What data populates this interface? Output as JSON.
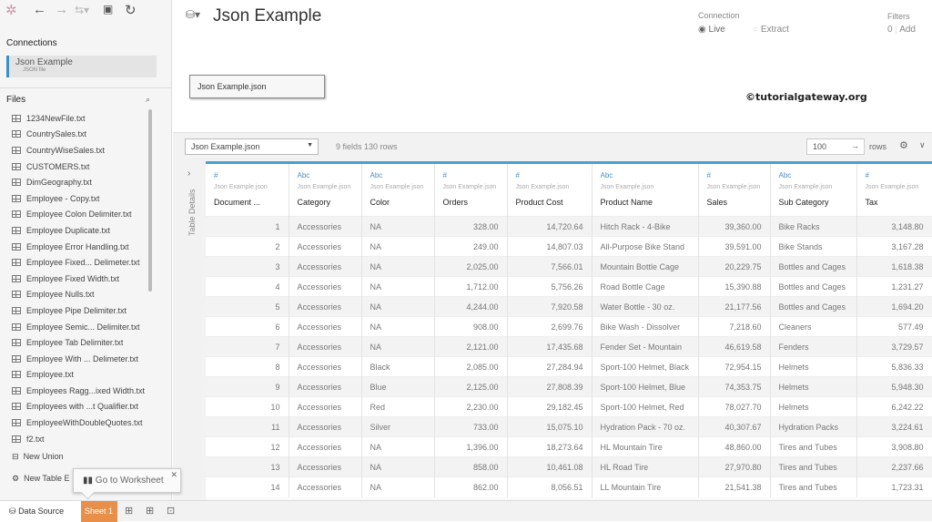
{
  "toolbar": {
    "icons": [
      "tableau-logo-icon",
      "back-icon",
      "forward-icon",
      "redo-icon",
      "save-icon",
      "refresh-icon"
    ]
  },
  "sidebar": {
    "connections_label": "Connections",
    "connection": {
      "name": "Json Example",
      "type": "JSON file"
    },
    "files_label": "Files",
    "files": [
      "1234NewFile.txt",
      "CountrySales.txt",
      "CountryWiseSales.txt",
      "CUSTOMERS.txt",
      "DimGeography.txt",
      "Employee - Copy.txt",
      "Employee Colon Delimiter.txt",
      "Employee Duplicate.txt",
      "Employee Error Handling.txt",
      "Employee Fixed... Delimeter.txt",
      "Employee Fixed Width.txt",
      "Employee Nulls.txt",
      "Employee Pipe Delimiter.txt",
      "Employee Semic... Delimiter.txt",
      "Employee Tab Delimiter.txt",
      "Employee With ... Delimeter.txt",
      "Employee.txt",
      "Employees Ragg...ixed Width.txt",
      "Employees with ...t Qualifier.txt",
      "EmployeeWithDoubleQuotes.txt",
      "f2.txt"
    ],
    "new_union": "New Union",
    "new_table_extension": "New Table E"
  },
  "header": {
    "title": "Json Example",
    "table_chip": "Json Example.json",
    "connection_label": "Connection",
    "live": "Live",
    "extract": "Extract",
    "selected": "Live",
    "filters_label": "Filters",
    "filters_count": "0",
    "filters_add": "Add",
    "watermark": "©tutorialgateway.org"
  },
  "gridbar": {
    "table_select": "Json Example.json",
    "fields_info": "9 fields 130 rows",
    "rows_value": "100",
    "rows_label": "rows"
  },
  "grid": {
    "details_label": "Table Details",
    "columns": [
      {
        "type": "#",
        "source": "Json Example.json",
        "name": "Document ...",
        "num": true
      },
      {
        "type": "Abc",
        "source": "Json Example.json",
        "name": "Category",
        "num": false
      },
      {
        "type": "Abc",
        "source": "Json Example.json",
        "name": "Color",
        "num": false
      },
      {
        "type": "#",
        "source": "Json Example.json",
        "name": "Orders",
        "num": true
      },
      {
        "type": "#",
        "source": "Json Example.json",
        "name": "Product Cost",
        "num": true
      },
      {
        "type": "Abc",
        "source": "Json Example.json",
        "name": "Product Name",
        "num": false
      },
      {
        "type": "#",
        "source": "Json Example.json",
        "name": "Sales",
        "num": true
      },
      {
        "type": "Abc",
        "source": "Json Example.json",
        "name": "Sub Category",
        "num": false
      },
      {
        "type": "#",
        "source": "Json Example.json",
        "name": "Tax",
        "num": true
      }
    ],
    "rows": [
      [
        "1",
        "Accessories",
        "NA",
        "328.00",
        "14,720.64",
        "Hitch Rack - 4-Bike",
        "39,360.00",
        "Bike Racks",
        "3,148.80"
      ],
      [
        "2",
        "Accessories",
        "NA",
        "249.00",
        "14,807.03",
        "All-Purpose Bike Stand",
        "39,591.00",
        "Bike Stands",
        "3,167.28"
      ],
      [
        "3",
        "Accessories",
        "NA",
        "2,025.00",
        "7,566.01",
        "Mountain Bottle Cage",
        "20,229.75",
        "Bottles and Cages",
        "1,618.38"
      ],
      [
        "4",
        "Accessories",
        "NA",
        "1,712.00",
        "5,756.26",
        "Road Bottle Cage",
        "15,390.88",
        "Bottles and Cages",
        "1,231.27"
      ],
      [
        "5",
        "Accessories",
        "NA",
        "4,244.00",
        "7,920.58",
        "Water Bottle - 30 oz.",
        "21,177.56",
        "Bottles and Cages",
        "1,694.20"
      ],
      [
        "6",
        "Accessories",
        "NA",
        "908.00",
        "2,699.76",
        "Bike Wash - Dissolver",
        "7,218.60",
        "Cleaners",
        "577.49"
      ],
      [
        "7",
        "Accessories",
        "NA",
        "2,121.00",
        "17,435.68",
        "Fender Set - Mountain",
        "46,619.58",
        "Fenders",
        "3,729.57"
      ],
      [
        "8",
        "Accessories",
        "Black",
        "2,085.00",
        "27,284.94",
        "Sport-100 Helmet, Black",
        "72,954.15",
        "Helmets",
        "5,836.33"
      ],
      [
        "9",
        "Accessories",
        "Blue",
        "2,125.00",
        "27,808.39",
        "Sport-100 Helmet, Blue",
        "74,353.75",
        "Helmets",
        "5,948.30"
      ],
      [
        "10",
        "Accessories",
        "Red",
        "2,230.00",
        "29,182.45",
        "Sport-100 Helmet, Red",
        "78,027.70",
        "Helmets",
        "6,242.22"
      ],
      [
        "11",
        "Accessories",
        "Silver",
        "733.00",
        "15,075.10",
        "Hydration Pack - 70 oz.",
        "40,307.67",
        "Hydration Packs",
        "3,224.61"
      ],
      [
        "12",
        "Accessories",
        "NA",
        "1,396.00",
        "18,273.64",
        "HL Mountain Tire",
        "48,860.00",
        "Tires and Tubes",
        "3,908.80"
      ],
      [
        "13",
        "Accessories",
        "NA",
        "858.00",
        "10,461.08",
        "HL Road Tire",
        "27,970.80",
        "Tires and Tubes",
        "2,237.66"
      ],
      [
        "14",
        "Accessories",
        "NA",
        "862.00",
        "8,056.51",
        "LL Mountain Tire",
        "21,541.38",
        "Tires and Tubes",
        "1,723.31"
      ]
    ]
  },
  "bottom": {
    "data_source": "Data Source",
    "sheet": "Sheet 1",
    "tooltip": "Go to Worksheet"
  },
  "colors": {
    "accent": "#4a9fd5",
    "sheet_tab": "#e8904a",
    "connection_bar": "#3a8fc7"
  }
}
